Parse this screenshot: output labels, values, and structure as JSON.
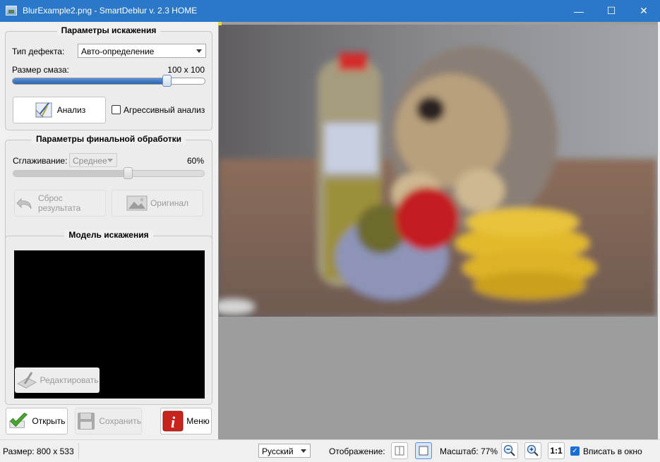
{
  "window": {
    "title": "BlurExample2.png - SmartDeblur v. 2.3 HOME",
    "minimize_glyph": "—",
    "maximize_glyph": "☐",
    "close_glyph": "✕"
  },
  "distortion": {
    "title": "Параметры искажения",
    "defect_label": "Тип дефекта:",
    "defect_value": "Авто-определение",
    "blur_size_label": "Размер смаза:",
    "blur_size_value": "100 x 100",
    "blur_size_fraction": 0.8,
    "analyze_button": "Анализ",
    "aggressive_label": "Агрессивный анализ",
    "aggressive_checked": false
  },
  "postprocess": {
    "title": "Параметры финальной обработки",
    "smoothing_label": "Сглаживание:",
    "smoothing_value": "Среднее",
    "smoothing_percent_text": "60%",
    "smoothing_fraction": 0.6,
    "reset_button": "Сброс результата",
    "original_button": "Оригинал"
  },
  "model": {
    "title": "Модель искажения",
    "edit_button": "Редактировать"
  },
  "actions": {
    "open_button": "Открыть",
    "save_button": "Сохранить",
    "menu_button": "Меню"
  },
  "status": {
    "size_text": "Размер: 800 x 533",
    "language": "Русский",
    "display_label": "Отображение:",
    "zoom_text": "Масштаб: 77%",
    "one_to_one": "1:1",
    "fit_label": "Вписать в окно",
    "fit_checked": true
  },
  "icons": {
    "analyze": "drafting-tools-icon",
    "reset": "undo-arrow-icon",
    "original": "picture-icon",
    "edit": "pen-tablet-icon",
    "open": "green-check-icon",
    "save": "floppy-disk-icon",
    "menu": "red-info-icon",
    "zoom_out": "zoom-out-icon",
    "zoom_in": "zoom-in-icon"
  },
  "colors": {
    "titlebar": "#2b78c8",
    "slider_fill": "#2d63ad",
    "check": "#1a6fd0"
  }
}
